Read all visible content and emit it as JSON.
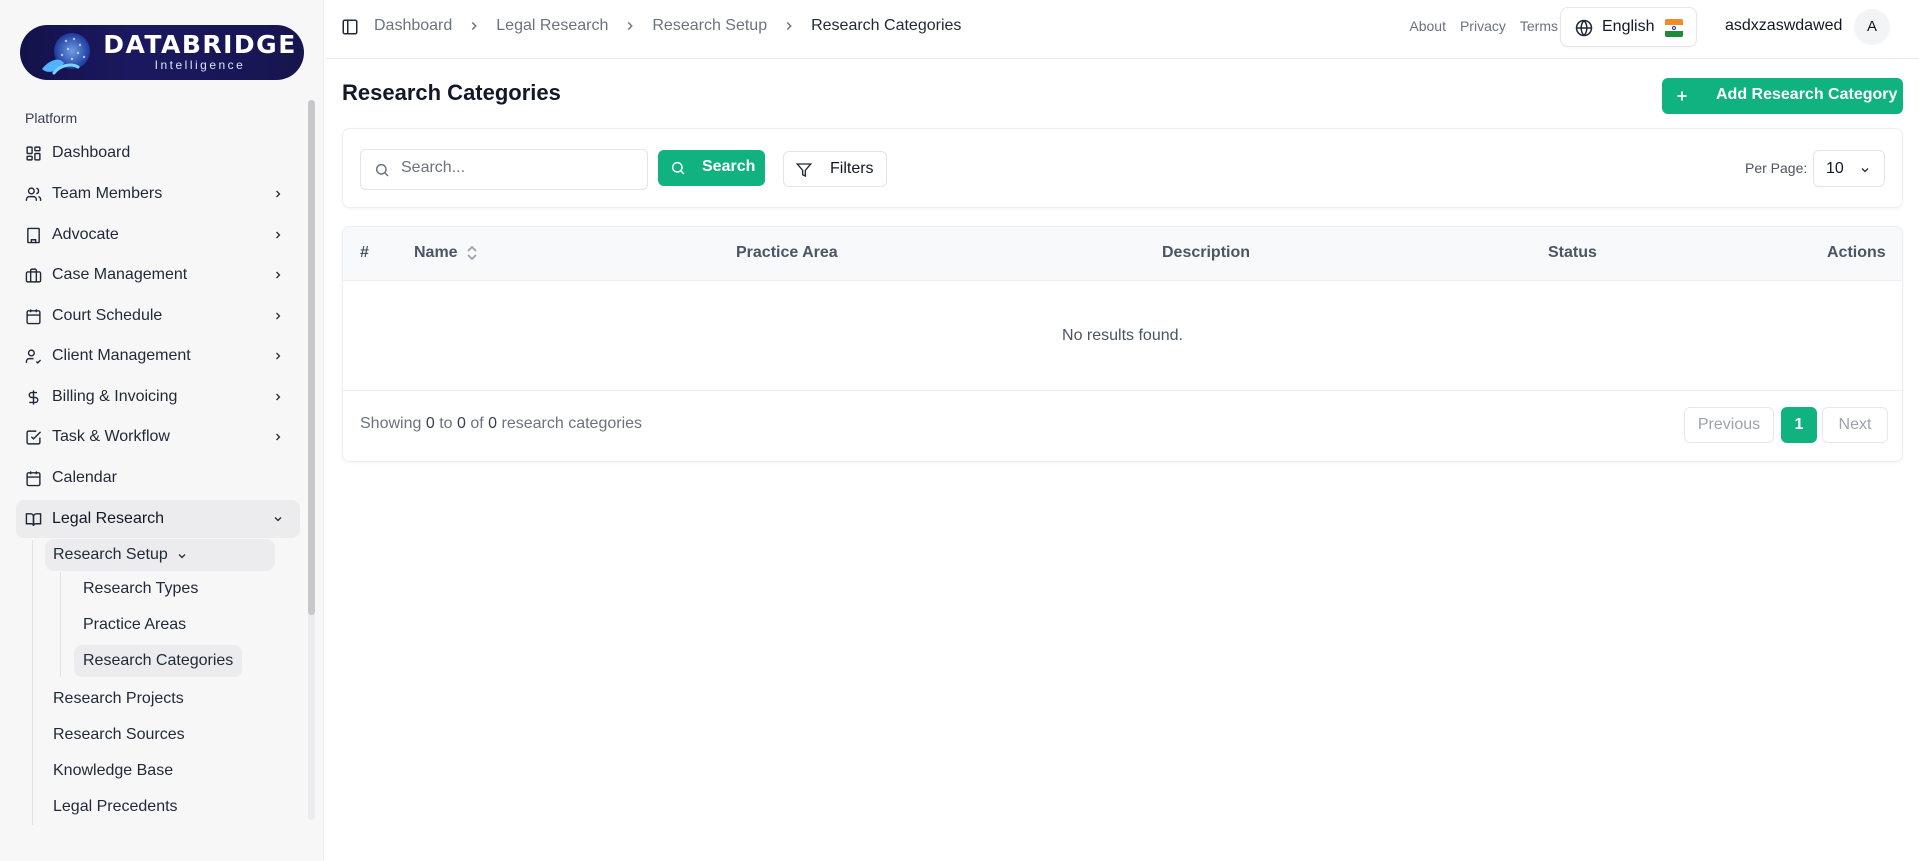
{
  "brand": {
    "title": "DATABRIDGE",
    "subtitle": "Intelligence"
  },
  "sidebar": {
    "group_label": "Platform",
    "items": [
      {
        "label": "Dashboard"
      },
      {
        "label": "Team Members"
      },
      {
        "label": "Advocate"
      },
      {
        "label": "Case Management"
      },
      {
        "label": "Court Schedule"
      },
      {
        "label": "Client Management"
      },
      {
        "label": "Billing & Invoicing"
      },
      {
        "label": "Task & Workflow"
      },
      {
        "label": "Calendar"
      },
      {
        "label": "Legal Research"
      }
    ],
    "research_setup": {
      "label": "Research Setup",
      "children": [
        {
          "label": "Research Types"
        },
        {
          "label": "Practice Areas"
        },
        {
          "label": "Research Categories"
        }
      ]
    },
    "legal_research_children": [
      {
        "label": "Research Projects"
      },
      {
        "label": "Research Sources"
      },
      {
        "label": "Knowledge Base"
      },
      {
        "label": "Legal Precedents"
      }
    ]
  },
  "header": {
    "breadcrumbs": [
      "Dashboard",
      "Legal Research",
      "Research Setup",
      "Research Categories"
    ],
    "links": [
      "About",
      "Privacy",
      "Terms"
    ],
    "language": "English",
    "user_name": "asdxzaswdawed",
    "avatar_initial": "A"
  },
  "page": {
    "title": "Research Categories",
    "add_button": "Add Research Category"
  },
  "toolbar": {
    "search_placeholder": "Search...",
    "search_value": "",
    "search_button": "Search",
    "filters_button": "Filters",
    "per_page_label": "Per Page:",
    "per_page_value": "10"
  },
  "table": {
    "columns": [
      "#",
      "Name",
      "Practice Area",
      "Description",
      "Status",
      "Actions"
    ],
    "empty_message": "No results found.",
    "footer": {
      "showing_prefix": "Showing",
      "from": "0",
      "to_word": "to",
      "to": "0",
      "of_word": "of",
      "total": "0",
      "suffix": "research categories"
    }
  },
  "pagination": {
    "previous": "Previous",
    "current_page": "1",
    "next": "Next"
  },
  "colors": {
    "accent": "#10b27f",
    "brand_bg": "#1b1860",
    "sidebar_bg": "#f7f7f8"
  },
  "icons": {
    "sidebar": [
      "dashboard-grid-icon",
      "users-icon",
      "building-icon",
      "briefcase-icon",
      "calendar-icon",
      "user-check-icon",
      "dollar-icon",
      "checkbox-icon",
      "calendar-icon",
      "book-open-icon"
    ],
    "header": [
      "sidebar-toggle-icon",
      "globe-icon",
      "india-flag-icon"
    ],
    "buttons": [
      "plus-icon",
      "search-icon",
      "filter-icon",
      "chevron-down-icon",
      "sort-icon"
    ]
  }
}
